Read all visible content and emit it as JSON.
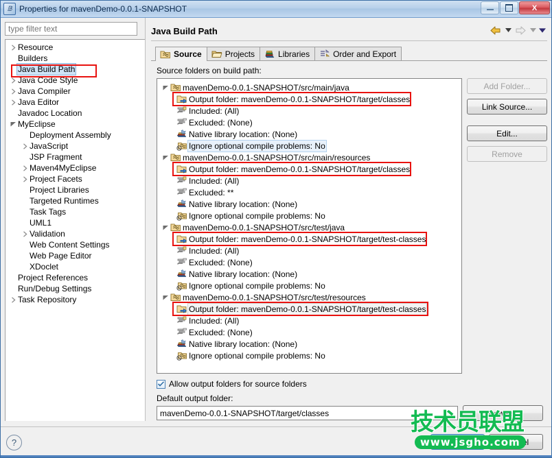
{
  "window": {
    "title": "Properties for mavenDemo-0.0.1-SNAPSHOT",
    "app_icon": "eclipse-icon",
    "minimize_label": "",
    "maximize_label": "",
    "close_label": "X"
  },
  "filter": {
    "placeholder": "type filter text",
    "value": ""
  },
  "tree": [
    {
      "label": "Resource",
      "indent": 1,
      "arrow": "collapsed",
      "selected": false
    },
    {
      "label": "Builders",
      "indent": 1,
      "arrow": "none",
      "selected": false
    },
    {
      "label": "Java Build Path",
      "indent": 1,
      "arrow": "none",
      "selected": true
    },
    {
      "label": "Java Code Style",
      "indent": 1,
      "arrow": "collapsed",
      "selected": false
    },
    {
      "label": "Java Compiler",
      "indent": 1,
      "arrow": "collapsed",
      "selected": false
    },
    {
      "label": "Java Editor",
      "indent": 1,
      "arrow": "collapsed",
      "selected": false
    },
    {
      "label": "Javadoc Location",
      "indent": 1,
      "arrow": "none",
      "selected": false
    },
    {
      "label": "MyEclipse",
      "indent": 1,
      "arrow": "expanded",
      "selected": false
    },
    {
      "label": "Deployment Assembly",
      "indent": 2,
      "arrow": "none",
      "selected": false
    },
    {
      "label": "JavaScript",
      "indent": 2,
      "arrow": "collapsed",
      "selected": false
    },
    {
      "label": "JSP Fragment",
      "indent": 2,
      "arrow": "none",
      "selected": false
    },
    {
      "label": "Maven4MyEclipse",
      "indent": 2,
      "arrow": "collapsed",
      "selected": false
    },
    {
      "label": "Project Facets",
      "indent": 2,
      "arrow": "collapsed",
      "selected": false
    },
    {
      "label": "Project Libraries",
      "indent": 2,
      "arrow": "none",
      "selected": false
    },
    {
      "label": "Targeted Runtimes",
      "indent": 2,
      "arrow": "none",
      "selected": false
    },
    {
      "label": "Task Tags",
      "indent": 2,
      "arrow": "none",
      "selected": false
    },
    {
      "label": "UML1",
      "indent": 2,
      "arrow": "none",
      "selected": false
    },
    {
      "label": "Validation",
      "indent": 2,
      "arrow": "collapsed",
      "selected": false
    },
    {
      "label": "Web Content Settings",
      "indent": 2,
      "arrow": "none",
      "selected": false
    },
    {
      "label": "Web Page Editor",
      "indent": 2,
      "arrow": "none",
      "selected": false
    },
    {
      "label": "XDoclet",
      "indent": 2,
      "arrow": "none",
      "selected": false
    },
    {
      "label": "Project References",
      "indent": 1,
      "arrow": "none",
      "selected": false
    },
    {
      "label": "Run/Debug Settings",
      "indent": 1,
      "arrow": "none",
      "selected": false
    },
    {
      "label": "Task Repository",
      "indent": 1,
      "arrow": "collapsed",
      "selected": false
    }
  ],
  "page": {
    "title": "Java Build Path",
    "back_icon": "back-arrow-icon",
    "forward_icon": "forward-arrow-icon",
    "menu_icon": "chevron-down-icon"
  },
  "tabs": [
    {
      "label": "Source",
      "icon": "source-folder-icon",
      "active": true
    },
    {
      "label": "Projects",
      "icon": "projects-icon",
      "active": false
    },
    {
      "label": "Libraries",
      "icon": "libraries-icon",
      "active": false
    },
    {
      "label": "Order and Export",
      "icon": "order-export-icon",
      "active": false
    }
  ],
  "section_label": "Source folders on build path:",
  "source_folders": [
    {
      "path": "mavenDemo-0.0.1-SNAPSHOT/src/main/java",
      "icon": "source-folder-icon",
      "children": [
        {
          "label": "Output folder: mavenDemo-0.0.1-SNAPSHOT/target/classes",
          "icon": "output-folder-icon",
          "highlighted": true,
          "selected": false
        },
        {
          "label": "Included: (All)",
          "icon": "included-filter-icon",
          "highlighted": false,
          "selected": false
        },
        {
          "label": "Excluded: (None)",
          "icon": "excluded-filter-icon",
          "highlighted": false,
          "selected": false
        },
        {
          "label": "Native library location: (None)",
          "icon": "native-library-icon",
          "highlighted": false,
          "selected": false
        },
        {
          "label": "Ignore optional compile problems: No",
          "icon": "ignore-problems-icon",
          "highlighted": false,
          "selected": true
        }
      ]
    },
    {
      "path": "mavenDemo-0.0.1-SNAPSHOT/src/main/resources",
      "icon": "source-folder-icon",
      "children": [
        {
          "label": "Output folder: mavenDemo-0.0.1-SNAPSHOT/target/classes",
          "icon": "output-folder-icon",
          "highlighted": true,
          "selected": false
        },
        {
          "label": "Included: (All)",
          "icon": "included-filter-icon",
          "highlighted": false,
          "selected": false
        },
        {
          "label": "Excluded: **",
          "icon": "excluded-filter-icon",
          "highlighted": false,
          "selected": false
        },
        {
          "label": "Native library location: (None)",
          "icon": "native-library-icon",
          "highlighted": false,
          "selected": false
        },
        {
          "label": "Ignore optional compile problems: No",
          "icon": "ignore-problems-icon",
          "highlighted": false,
          "selected": false
        }
      ]
    },
    {
      "path": "mavenDemo-0.0.1-SNAPSHOT/src/test/java",
      "icon": "source-folder-icon",
      "children": [
        {
          "label": "Output folder: mavenDemo-0.0.1-SNAPSHOT/target/test-classes",
          "icon": "output-folder-icon",
          "highlighted": true,
          "selected": false
        },
        {
          "label": "Included: (All)",
          "icon": "included-filter-icon",
          "highlighted": false,
          "selected": false
        },
        {
          "label": "Excluded: (None)",
          "icon": "excluded-filter-icon",
          "highlighted": false,
          "selected": false
        },
        {
          "label": "Native library location: (None)",
          "icon": "native-library-icon",
          "highlighted": false,
          "selected": false
        },
        {
          "label": "Ignore optional compile problems: No",
          "icon": "ignore-problems-icon",
          "highlighted": false,
          "selected": false
        }
      ]
    },
    {
      "path": "mavenDemo-0.0.1-SNAPSHOT/src/test/resources",
      "icon": "source-folder-icon",
      "children": [
        {
          "label": "Output folder: mavenDemo-0.0.1-SNAPSHOT/target/test-classes",
          "icon": "output-folder-icon",
          "highlighted": true,
          "selected": true
        },
        {
          "label": "Included: (All)",
          "icon": "included-filter-icon",
          "highlighted": false,
          "selected": false
        },
        {
          "label": "Excluded: (None)",
          "icon": "excluded-filter-icon",
          "highlighted": false,
          "selected": false
        },
        {
          "label": "Native library location: (None)",
          "icon": "native-library-icon",
          "highlighted": false,
          "selected": false
        },
        {
          "label": "Ignore optional compile problems: No",
          "icon": "ignore-problems-icon",
          "highlighted": false,
          "selected": false
        }
      ]
    }
  ],
  "side_buttons": [
    {
      "label": "Add Folder...",
      "enabled": false
    },
    {
      "label": "Link Source...",
      "enabled": true
    },
    {
      "label": "Edit...",
      "enabled": true
    },
    {
      "label": "Remove",
      "enabled": false
    }
  ],
  "allow_output_folders": {
    "label": "Allow output folders for source folders",
    "checked": true
  },
  "default_output": {
    "label": "Default output folder:",
    "value": "mavenDemo-0.0.1-SNAPSHOT/target/classes",
    "browse_label": "Browse..."
  },
  "footer": {
    "help_icon": "help-question-icon",
    "ok_label": "OK",
    "cancel_label": "Cancel"
  },
  "watermark": {
    "cn_text": "技术员联盟",
    "url_text": "www.jsgho.com",
    "color": "#13bb52"
  }
}
